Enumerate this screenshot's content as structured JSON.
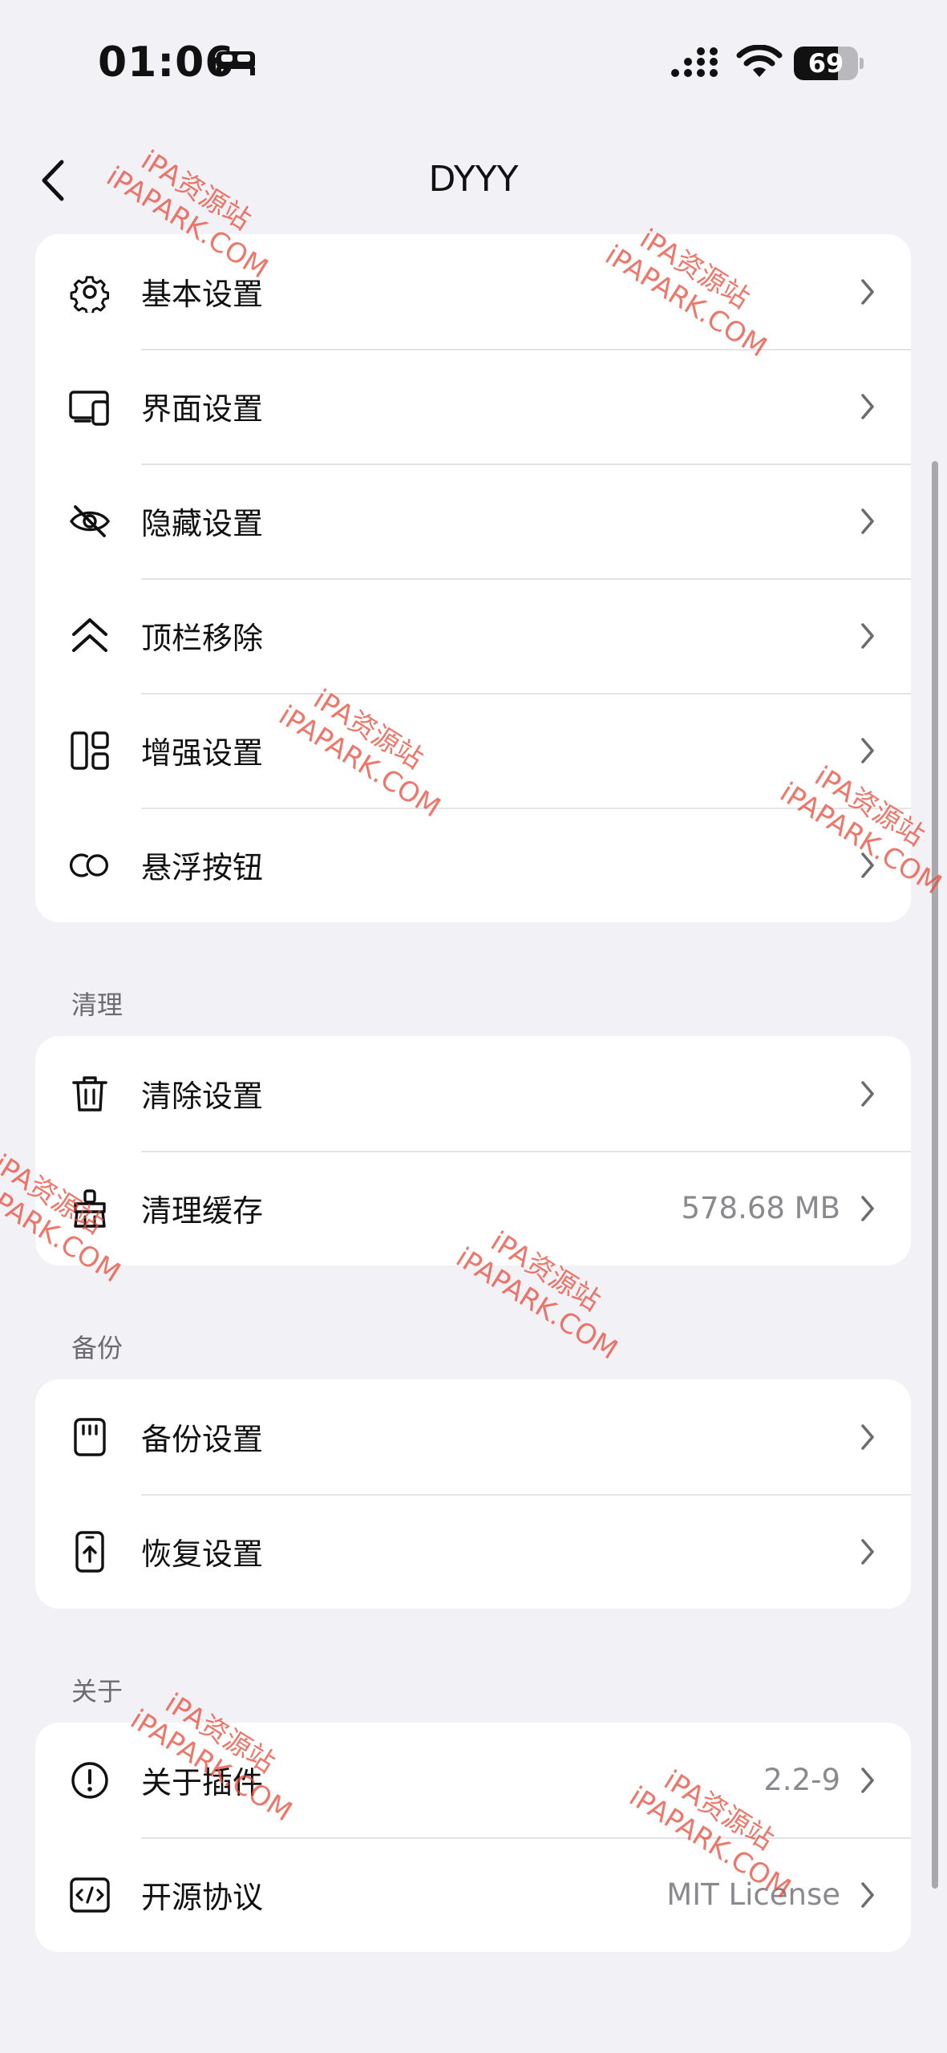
{
  "status_bar": {
    "time": "01:06",
    "battery": "69"
  },
  "nav": {
    "title": "DYYY"
  },
  "groups": {
    "main": {
      "items": [
        {
          "label": "基本设置",
          "icon": "gear-icon"
        },
        {
          "label": "界面设置",
          "icon": "devices-icon"
        },
        {
          "label": "隐藏设置",
          "icon": "eye-slash-icon"
        },
        {
          "label": "顶栏移除",
          "icon": "double-chevron-up-icon"
        },
        {
          "label": "增强设置",
          "icon": "layout-icon"
        },
        {
          "label": "悬浮按钮",
          "icon": "float-button-icon"
        }
      ]
    },
    "clean": {
      "header": "清理",
      "items": [
        {
          "label": "清除设置",
          "icon": "trash-icon"
        },
        {
          "label": "清理缓存",
          "icon": "broom-icon",
          "value": "578.68 MB"
        }
      ]
    },
    "backup": {
      "header": "备份",
      "items": [
        {
          "label": "备份设置",
          "icon": "sd-card-icon"
        },
        {
          "label": "恢复设置",
          "icon": "phone-upload-icon"
        }
      ]
    },
    "about": {
      "header": "关于",
      "items": [
        {
          "label": "关于插件",
          "icon": "info-icon",
          "value": "2.2-9"
        },
        {
          "label": "开源协议",
          "icon": "code-icon",
          "value": "MIT License"
        }
      ]
    }
  },
  "watermark": {
    "line1": "iPA资源站",
    "line2": "iPAPARK.COM"
  },
  "colors": {
    "background": "#f2f2f6",
    "card": "#ffffff",
    "watermark": "#e64a3a",
    "secondary_text": "#8a8a8e"
  }
}
